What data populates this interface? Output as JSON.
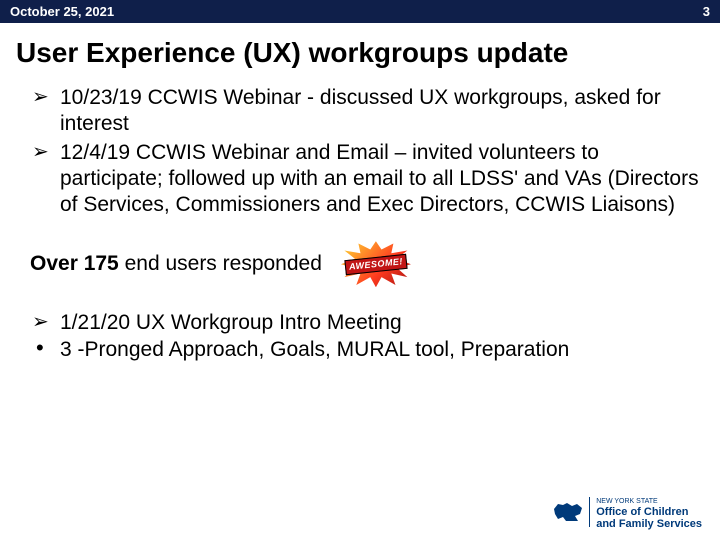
{
  "header": {
    "date": "October 25, 2021",
    "page_number": "3"
  },
  "title": "User Experience (UX) workgroups update",
  "bullets_top": [
    "10/23/19 CCWIS Webinar - discussed UX workgroups, asked for interest",
    "12/4/19 CCWIS Webinar and Email – invited volunteers to participate; followed up with an email to all LDSS' and VAs (Directors of Services, Commissioners and Exec Directors, CCWIS Liaisons)"
  ],
  "respond": {
    "bold": "Over 175",
    "rest": " end users responded",
    "burst_label": "AWESOME!"
  },
  "bullets_bottom": {
    "arrow": "1/21/20 UX Workgroup Intro Meeting",
    "dot": "3 -Pronged Approach, Goals, MURAL tool, Preparation"
  },
  "footer": {
    "state_small": "NEW YORK STATE",
    "line1": "Office of Children",
    "line2": "and Family Services"
  }
}
